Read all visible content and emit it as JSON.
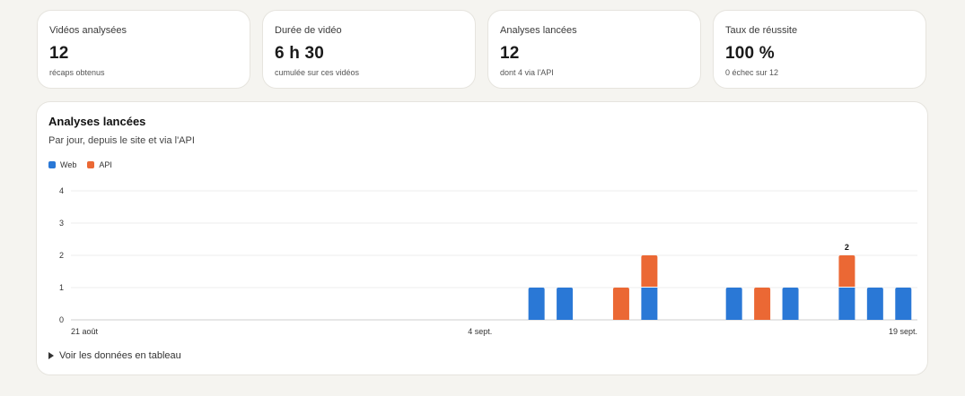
{
  "stats": [
    {
      "label": "Vidéos analysées",
      "value": "12",
      "sub": "récaps obtenus"
    },
    {
      "label": "Durée de vidéo",
      "value": "6 h 30",
      "sub": "cumulée sur ces vidéos"
    },
    {
      "label": "Analyses lancées",
      "value": "12",
      "sub": "dont 4 via l'API"
    },
    {
      "label": "Taux de réussite",
      "value": "100 %",
      "sub": "0 échec sur 12"
    }
  ],
  "chart_section": {
    "title": "Analyses lancées",
    "subtitle": "Par jour, depuis le site et via l'API",
    "table_toggle": "Voir les données en tableau"
  },
  "colors": {
    "web": "#2a78d6",
    "api": "#eb6834"
  },
  "chart_data": {
    "type": "bar",
    "stacked": true,
    "x": [
      "21 août",
      "22 août",
      "23 août",
      "24 août",
      "25 août",
      "26 août",
      "27 août",
      "28 août",
      "29 août",
      "30 août",
      "31 août",
      "1 sept.",
      "2 sept.",
      "3 sept.",
      "4 sept.",
      "5 sept.",
      "6 sept.",
      "7 sept.",
      "8 sept.",
      "9 sept.",
      "10 sept.",
      "11 sept.",
      "12 sept.",
      "13 sept.",
      "14 sept.",
      "15 sept.",
      "16 sept.",
      "17 sept.",
      "18 sept.",
      "19 sept."
    ],
    "x_tick_labels": [
      "21 août",
      "4 sept.",
      "19 sept."
    ],
    "series": [
      {
        "name": "Web",
        "color": "#2a78d6",
        "values": [
          0,
          0,
          0,
          0,
          0,
          0,
          0,
          0,
          0,
          0,
          0,
          0,
          0,
          0,
          0,
          0,
          1,
          1,
          0,
          0,
          1,
          0,
          0,
          1,
          0,
          1,
          0,
          1,
          1,
          1
        ]
      },
      {
        "name": "API",
        "color": "#eb6834",
        "values": [
          0,
          0,
          0,
          0,
          0,
          0,
          0,
          0,
          0,
          0,
          0,
          0,
          0,
          0,
          0,
          0,
          0,
          0,
          0,
          1,
          1,
          0,
          0,
          0,
          1,
          0,
          0,
          1,
          0,
          0
        ]
      }
    ],
    "data_labels": [
      {
        "x": "17 sept.",
        "label": "2"
      }
    ],
    "y_ticks": [
      0,
      1,
      2,
      3,
      4
    ],
    "ylim": [
      0,
      4
    ],
    "grid": true,
    "legend": "top-left"
  }
}
